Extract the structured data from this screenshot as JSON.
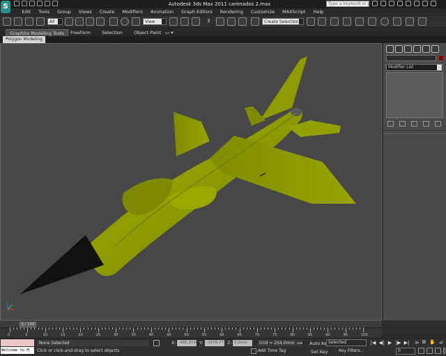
{
  "titlebar": {
    "app_letter": "S",
    "title": "Autodesk 3ds Max  2011     carenados 2.max",
    "search_placeholder": "Type a keyword or phrase"
  },
  "menu": [
    "Edit",
    "Tools",
    "Group",
    "Views",
    "Create",
    "Modifiers",
    "Animation",
    "Graph Editors",
    "Rendering",
    "Customize",
    "MAXScript",
    "Help"
  ],
  "toolbar": {
    "selection_filter": "All",
    "ref_coord": "View",
    "snap_label": "3",
    "named_selection": "Create Selection Se"
  },
  "ribbon": {
    "tabs": [
      "Graphite Modeling Tools",
      "Freeform",
      "Selection",
      "Object Paint"
    ],
    "active_tab": "Graphite Modeling Tools",
    "sub_tab": "Polygon Modeling"
  },
  "viewport": {
    "background": "#474747",
    "model_color": "#8f9c00",
    "nose_color": "#111111"
  },
  "command_panel": {
    "modifier_list": "Modifier List",
    "object_color": "#8b0000"
  },
  "timeline": {
    "frame_display": "0 / 100",
    "ticks": [
      0,
      5,
      10,
      15,
      20,
      25,
      30,
      35,
      40,
      45,
      50,
      55,
      60,
      65,
      70,
      75,
      80,
      85,
      90,
      95,
      100
    ]
  },
  "status": {
    "maxscript_text": "Welcome to M",
    "selection": "None Selected",
    "prompt": "Click or click-and-drag to select objects",
    "x_label": "X:",
    "x_value": "-486,303m",
    "y_label": "Y:",
    "y_value": "-2878,777n",
    "z_label": "Z:",
    "z_value": "0,0mm",
    "grid": "Grid = 254,0mm",
    "add_time_tag": "Add Time Tag",
    "auto_key": "Auto Key",
    "set_key": "Set Key",
    "key_mode": "Selected",
    "key_filters": "Key Filters...",
    "current_frame": "0"
  }
}
